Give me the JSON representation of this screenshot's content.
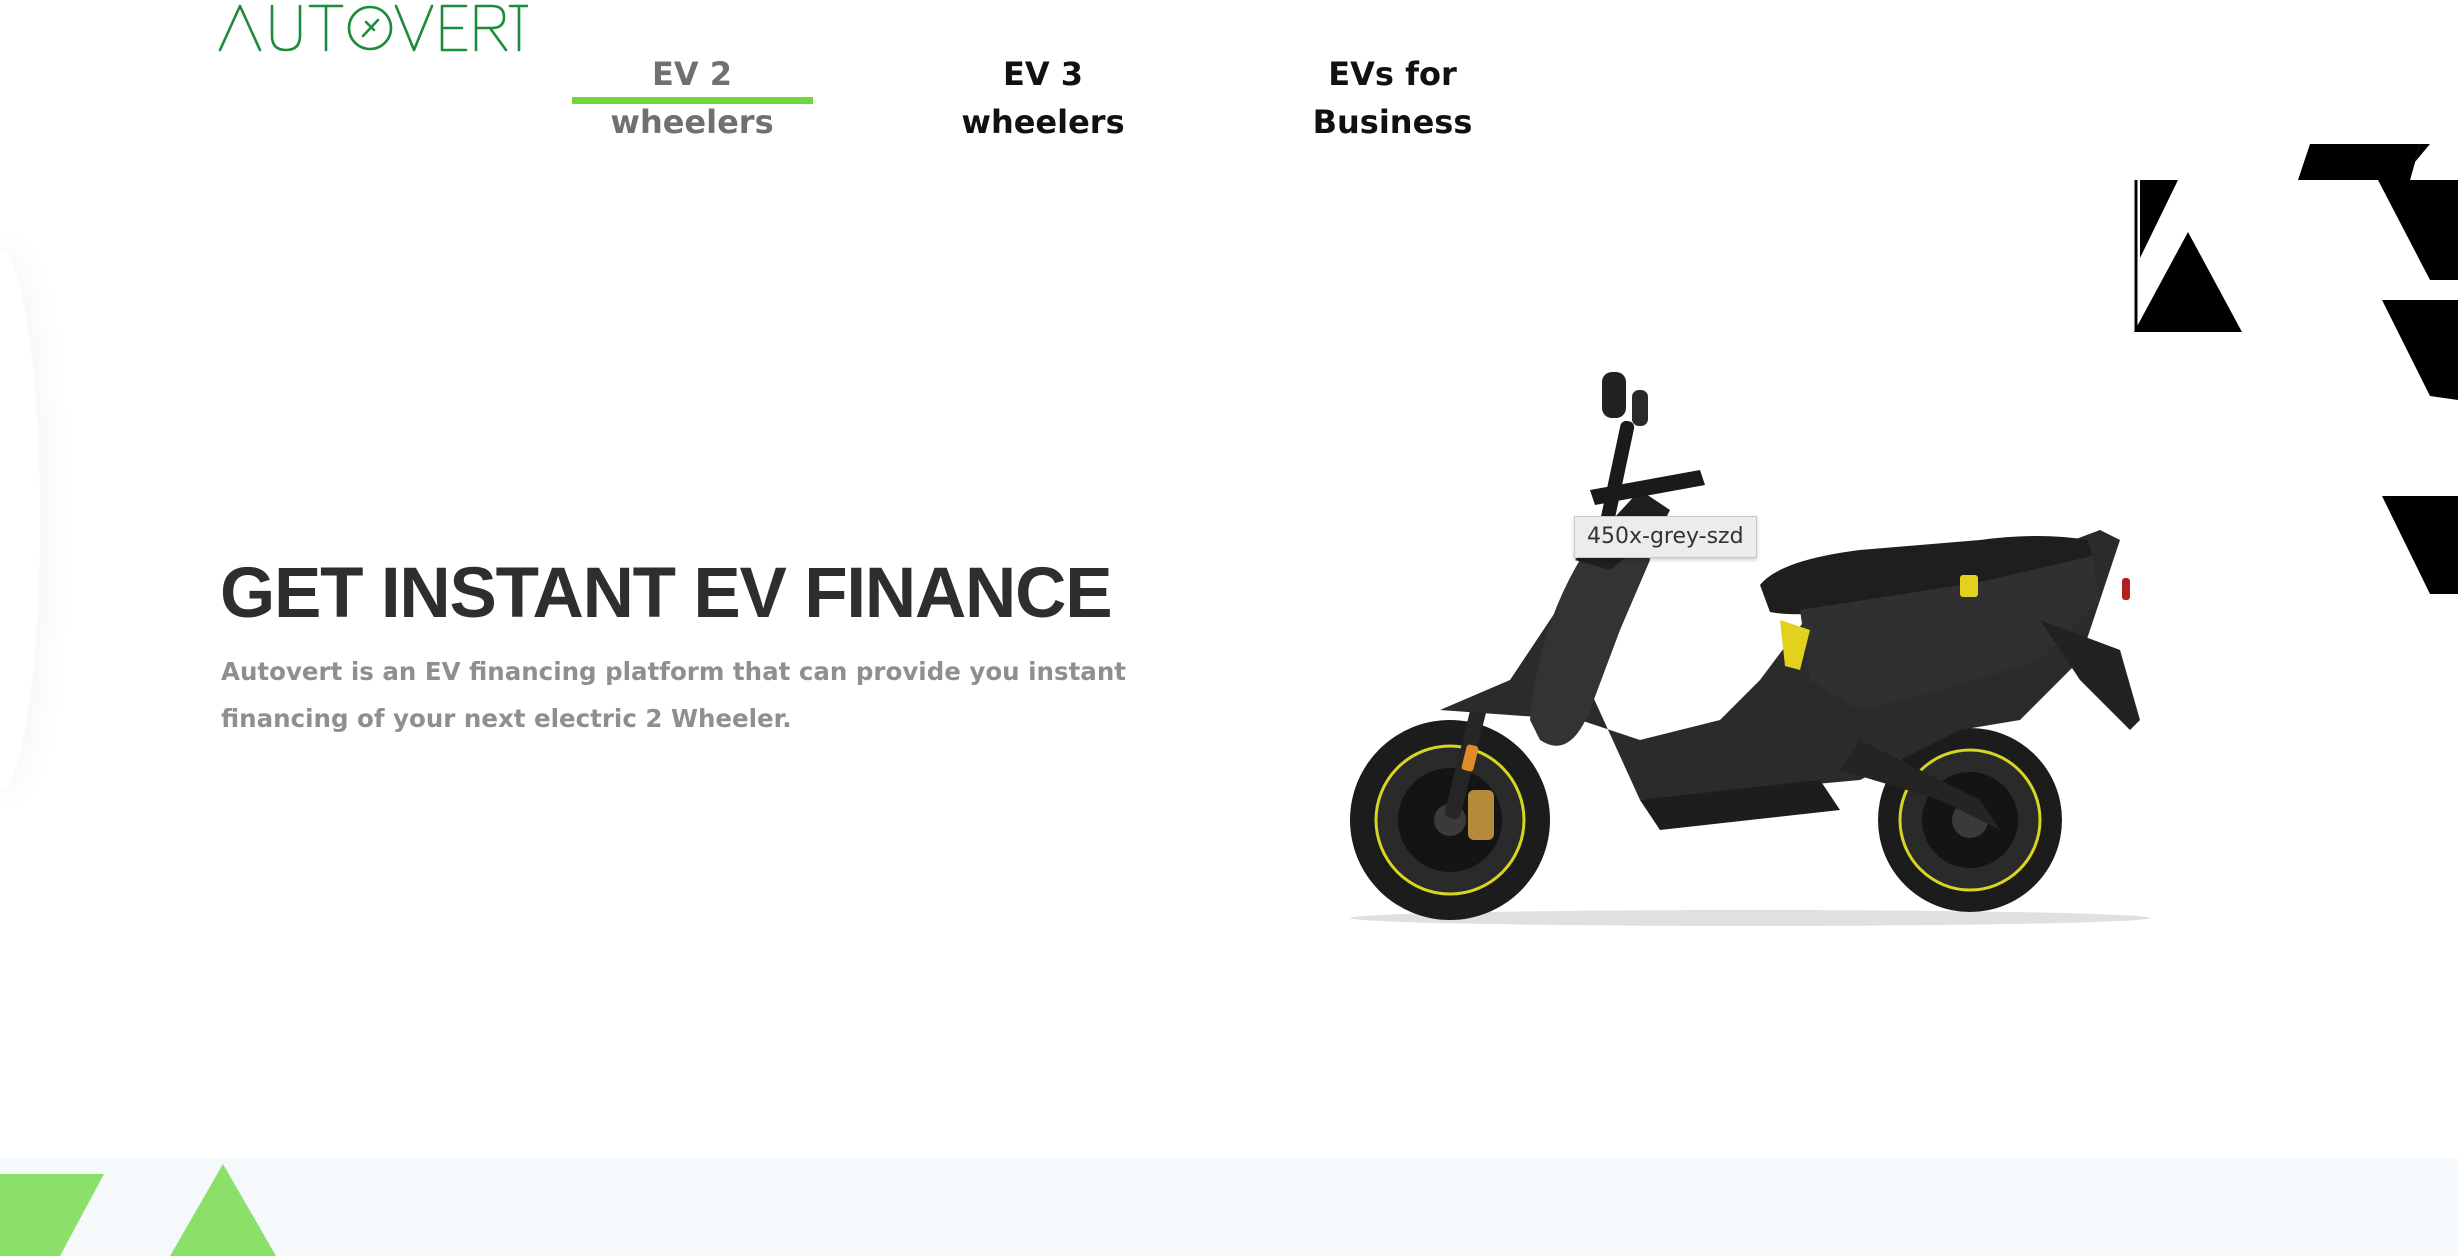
{
  "brand": {
    "logo_text": "AUTOVERT",
    "logo_color": "#1c8c3c"
  },
  "nav": {
    "tabs": [
      {
        "label": "EV 2 wheelers",
        "active": true
      },
      {
        "label": "EV 3 wheelers",
        "active": false
      },
      {
        "label": "EVs for Business",
        "active": false
      }
    ],
    "active_color": "#6fd63c"
  },
  "hero": {
    "title": "GET INSTANT EV FINANCE",
    "description": "Autovert is an EV financing platform that can provide you instant financing of your next electric 2 Wheeler."
  },
  "image": {
    "tooltip": "450x-grey-szd",
    "subject": "electric-scooter"
  },
  "colors": {
    "accent_green": "#6fd63c",
    "deco_black": "#000000",
    "title_text": "#2e2e2e",
    "body_text": "#8f8f8f"
  }
}
